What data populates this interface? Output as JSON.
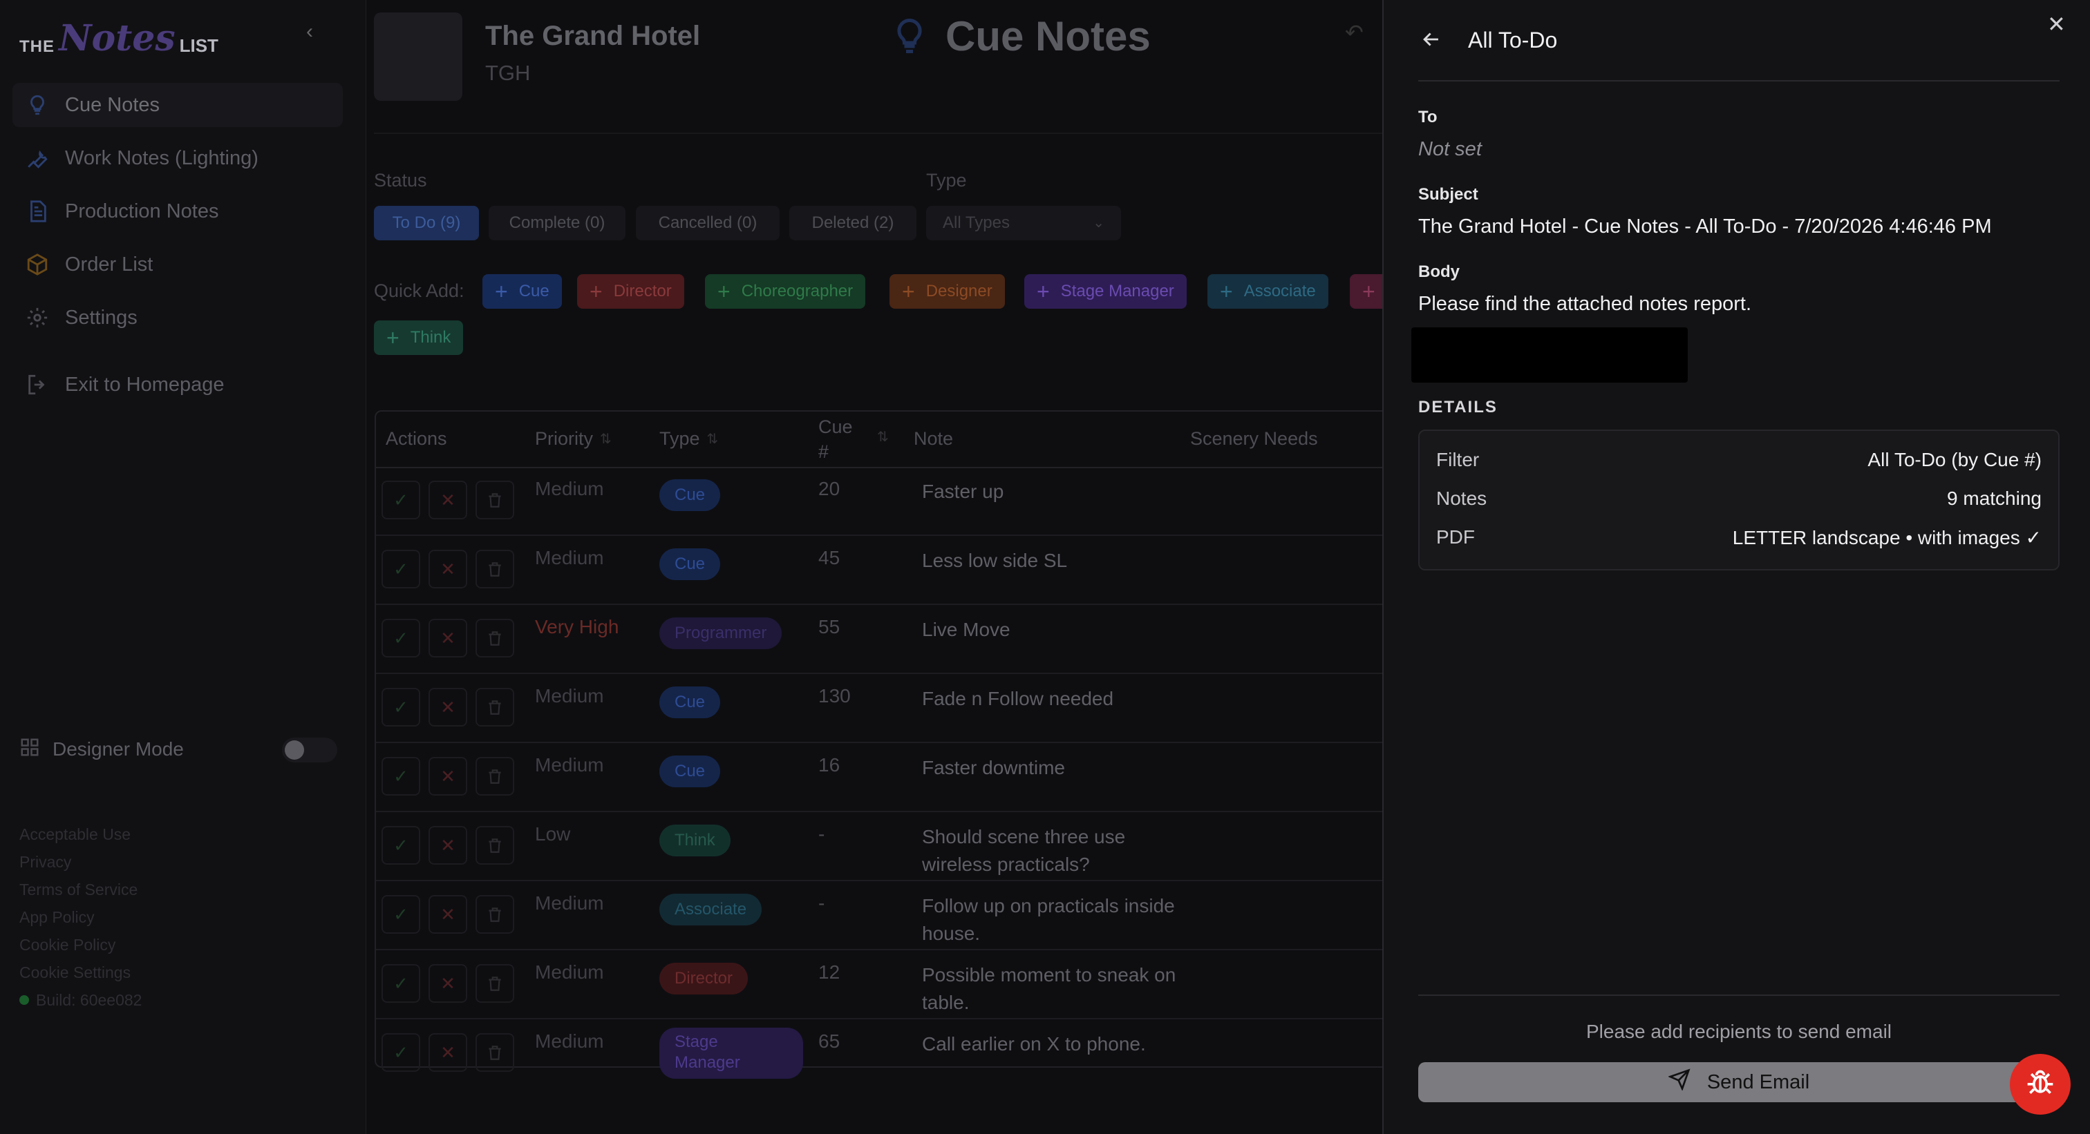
{
  "sidebar": {
    "logo": {
      "the": "THE",
      "notes": "Notes",
      "list": "LIST"
    },
    "nav": [
      {
        "label": "Cue Notes",
        "icon": "lightbulb-icon"
      },
      {
        "label": "Work Notes (Lighting)",
        "icon": "wrench-icon"
      },
      {
        "label": "Production Notes",
        "icon": "document-icon"
      },
      {
        "label": "Order List",
        "icon": "box-icon"
      },
      {
        "label": "Settings",
        "icon": "gear-icon"
      },
      {
        "label": "Exit to Homepage",
        "icon": "exit-icon"
      }
    ],
    "designer_mode": "Designer Mode",
    "legal": [
      "Acceptable Use",
      "Privacy",
      "Terms of Service",
      "App Policy",
      "Cookie Policy",
      "Cookie Settings"
    ],
    "build": "Build: 60ee082"
  },
  "main": {
    "production_title": "The Grand Hotel",
    "production_abbr": "TGH",
    "page_title": "Cue Notes",
    "status_label": "Status",
    "status_chips": [
      "To Do (9)",
      "Complete (0)",
      "Cancelled (0)",
      "Deleted (2)"
    ],
    "type_label": "Type",
    "type_select": "All Types",
    "quick_add_label": "Quick Add:",
    "quick_add": [
      {
        "label": "Cue",
        "bg": "#162a58",
        "fg": "#3a5ba8"
      },
      {
        "label": "Director",
        "bg": "#4a1a1c",
        "fg": "#8a3a3c"
      },
      {
        "label": "Choreographer",
        "bg": "#153a25",
        "fg": "#2f7a4a"
      },
      {
        "label": "Designer",
        "bg": "#4a2614",
        "fg": "#8c4b25"
      },
      {
        "label": "Stage Manager",
        "bg": "#2e1d55",
        "fg": "#6a4bb0"
      },
      {
        "label": "Associate",
        "bg": "#153040",
        "fg": "#2e6a84"
      },
      {
        "label": "",
        "bg": "#4a1a2e",
        "fg": "#8a3a5a"
      },
      {
        "label": "Think",
        "bg": "#163a30",
        "fg": "#2f7a63"
      }
    ],
    "table": {
      "headers": {
        "actions": "Actions",
        "priority": "Priority",
        "type": "Type",
        "cue": "Cue #",
        "note": "Note",
        "scenery": "Scenery Needs"
      },
      "rows": [
        {
          "priority": "Medium",
          "type": "Cue",
          "cue": "20",
          "note": "Faster up"
        },
        {
          "priority": "Medium",
          "type": "Cue",
          "cue": "45",
          "note": "Less low side SL"
        },
        {
          "priority": "Very High",
          "type": "Programmer",
          "cue": "55",
          "note": "Live Move"
        },
        {
          "priority": "Medium",
          "type": "Cue",
          "cue": "130",
          "note": "Fade n Follow needed"
        },
        {
          "priority": "Medium",
          "type": "Cue",
          "cue": "16",
          "note": "Faster downtime"
        },
        {
          "priority": "Low",
          "type": "Think",
          "cue": "-",
          "note": "Should scene three use wireless practicals?"
        },
        {
          "priority": "Medium",
          "type": "Associate",
          "cue": "-",
          "note": "Follow up on practicals inside house."
        },
        {
          "priority": "Medium",
          "type": "Director",
          "cue": "12",
          "note": "Possible moment to sneak on table."
        },
        {
          "priority": "Medium",
          "type": "Stage Manager",
          "cue": "65",
          "note": "Call earlier on X to phone."
        }
      ]
    }
  },
  "panel": {
    "title": "All To-Do",
    "to_label": "To",
    "to_value": "Not set",
    "subject_label": "Subject",
    "subject_value": "The Grand Hotel - Cue Notes - All To-Do - 7/20/2026 4:46:46 PM",
    "body_label": "Body",
    "body_value": "Please find the attached notes report.",
    "details_label": "DETAILS",
    "details": [
      {
        "k": "Filter",
        "v": "All To-Do (by Cue #)"
      },
      {
        "k": "Notes",
        "v": "9 matching"
      },
      {
        "k": "PDF",
        "v": "LETTER landscape • with images ✓"
      }
    ],
    "hint": "Please add recipients to send email",
    "send_label": "Send Email"
  }
}
